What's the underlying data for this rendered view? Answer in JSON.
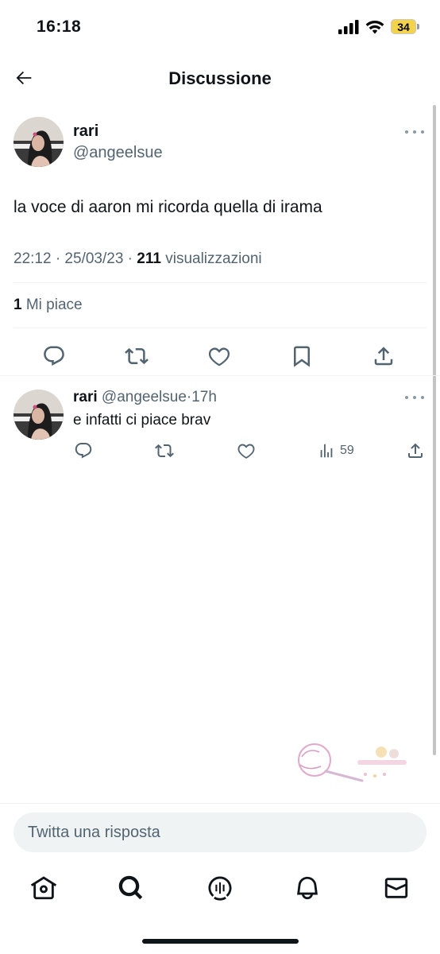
{
  "status_bar": {
    "time": "16:18",
    "battery": "34",
    "battery_color": "#f3d34a"
  },
  "header": {
    "title": "Discussione",
    "back_icon": "arrow-left-icon"
  },
  "main_tweet": {
    "name": "rari",
    "handle": "@angeelsue",
    "text": "la voce di aaron mi ricorda quella di irama",
    "time": "22:12 · 25/03/23 · ",
    "views_count": "211",
    "views_label": " visualizzazioni",
    "likes_count": "1",
    "likes_label": " Mi piace",
    "actions": [
      "reply-icon",
      "retweet-icon",
      "like-icon",
      "bookmark-icon",
      "share-icon"
    ]
  },
  "reply": {
    "name": "rari",
    "handle": "@angeelsue",
    "separator": "·",
    "time": "17h",
    "text": "e infatti ci piace brav",
    "views": "59",
    "actions": [
      "reply-icon",
      "retweet-icon",
      "like-icon",
      "views-icon",
      "share-icon"
    ]
  },
  "reply_bar": {
    "placeholder": "Twitta una risposta"
  },
  "bottom_nav": [
    "home-icon",
    "search-icon",
    "spaces-icon",
    "notifications-icon",
    "messages-icon"
  ],
  "colors": {
    "text": "#0f1419",
    "secondary": "#536471",
    "divider": "#eff3f4"
  }
}
